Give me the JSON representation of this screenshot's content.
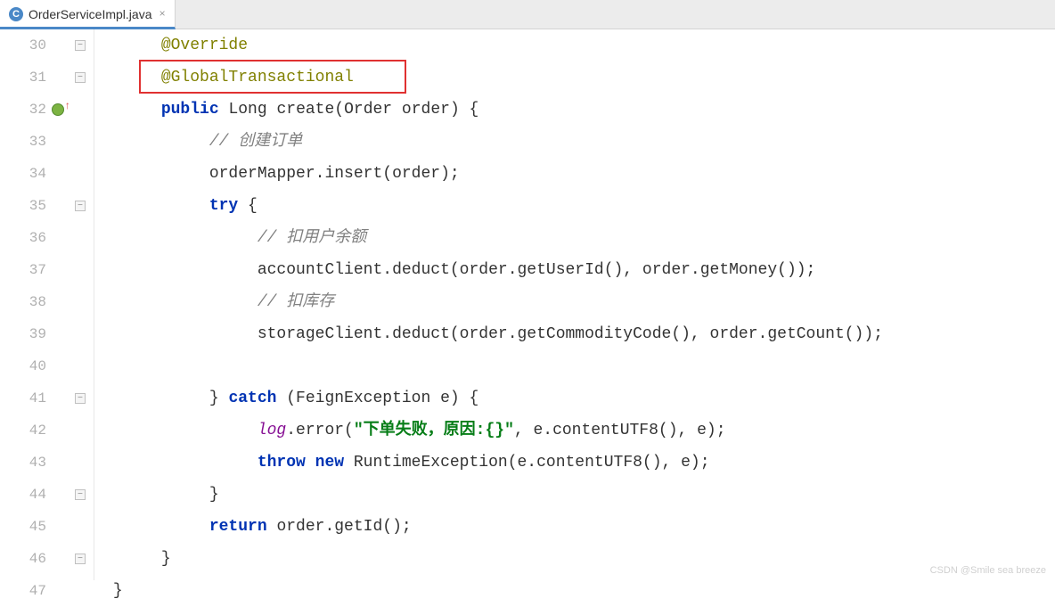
{
  "tab": {
    "icon_letter": "C",
    "filename": "OrderServiceImpl.java",
    "close": "×"
  },
  "lines": {
    "l30": {
      "num": "30",
      "ann": "@Override"
    },
    "l31": {
      "num": "31",
      "ann": "@GlobalTransactional"
    },
    "l32": {
      "num": "32",
      "kw_public": "public",
      "type": "Long",
      "method": "create",
      "param_type": "Order",
      "param_name": "order",
      "brace": ") {"
    },
    "l33": {
      "num": "33",
      "cm": "// 创建订单"
    },
    "l34": {
      "num": "34",
      "field": "orderMapper",
      "rest": ".insert(order);"
    },
    "l35": {
      "num": "35",
      "kw_try": "try",
      "brace": " {"
    },
    "l36": {
      "num": "36",
      "cm": "// 扣用户余额"
    },
    "l37": {
      "num": "37",
      "field": "accountClient",
      "rest": ".deduct(order.getUserId(), order.getMoney());"
    },
    "l38": {
      "num": "38",
      "cm": "// 扣库存"
    },
    "l39": {
      "num": "39",
      "field": "storageClient",
      "rest": ".deduct(order.getCommodityCode(), order.getCount());"
    },
    "l40": {
      "num": "40"
    },
    "l41": {
      "num": "41",
      "brace_close": "} ",
      "kw_catch": "catch",
      "rest": " (FeignException e) {"
    },
    "l42": {
      "num": "42",
      "log": "log",
      "method": ".error(",
      "str": "\"下单失败，原因:{}\"",
      "rest": ", e.contentUTF8(), e);"
    },
    "l43": {
      "num": "43",
      "kw_throw": "throw",
      "kw_new": "new",
      "rest": " RuntimeException(e.contentUTF8(), e);"
    },
    "l44": {
      "num": "44",
      "brace": "}"
    },
    "l45": {
      "num": "45",
      "kw_return": "return",
      "rest": " order.getId();"
    },
    "l46": {
      "num": "46",
      "brace": "}"
    },
    "l47": {
      "num": "47",
      "brace": "}"
    }
  },
  "watermark": "CSDN @Smile sea breeze"
}
